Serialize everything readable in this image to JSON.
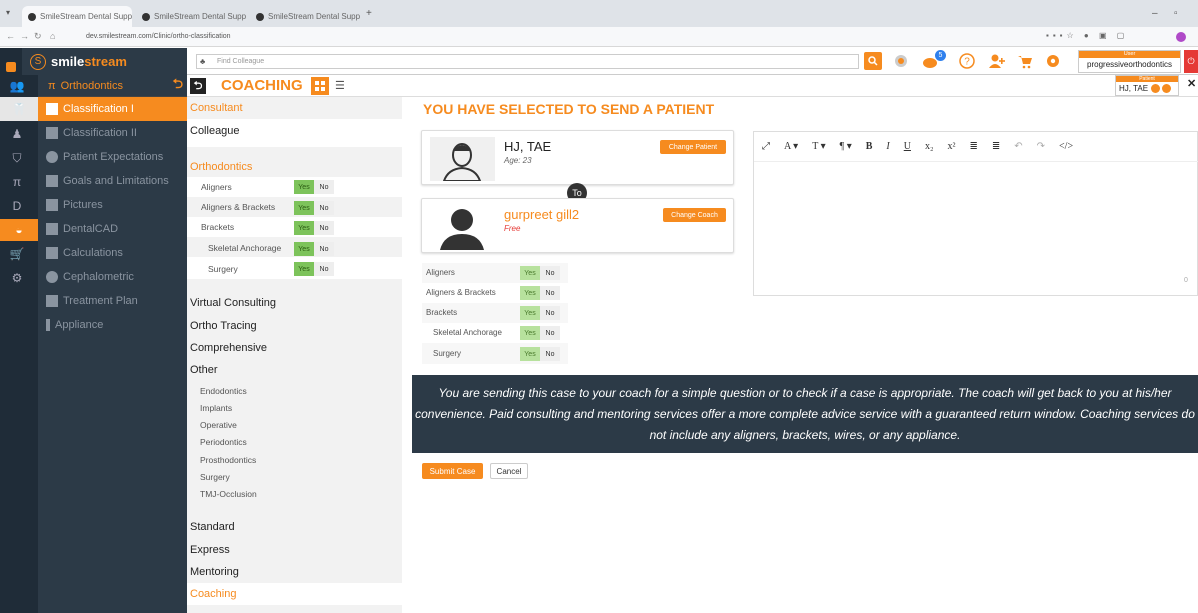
{
  "browser": {
    "tabs": [
      {
        "label": "SmileStream Dental Supply"
      },
      {
        "label": "SmileStream Dental Supply"
      },
      {
        "label": "SmileStream Dental Supply"
      }
    ],
    "url": "dev.smilestream.com/Clinic/ortho-classification"
  },
  "header": {
    "brand_part1": "smile",
    "brand_part2": "stream",
    "brand_logo": "S",
    "search_placeholder": "Find Colleague",
    "notification_count": "5",
    "user_role": "User",
    "user_name": "progressiveorthodontics",
    "patient_label": "Patient",
    "patient_name": "HJ, TAE"
  },
  "sidebar": {
    "header": "Orthodontics",
    "items": [
      {
        "label": "Classification I",
        "active": true
      },
      {
        "label": "Classification II"
      },
      {
        "label": "Patient Expectations"
      },
      {
        "label": "Goals and Limitations"
      },
      {
        "label": "Pictures"
      },
      {
        "label": "DentalCAD"
      },
      {
        "label": "Calculations"
      },
      {
        "label": "Cephalometric"
      },
      {
        "label": "Treatment Plan"
      },
      {
        "label": "Appliance"
      }
    ]
  },
  "coaching": {
    "title": "COACHING"
  },
  "options": {
    "consultant": "Consultant",
    "colleague": "Colleague",
    "orthodontics": "Orthodontics",
    "ortho_items": [
      {
        "label": "Aligners",
        "yes": "Yes",
        "no": "No"
      },
      {
        "label": "Aligners & Brackets",
        "yes": "Yes",
        "no": "No"
      },
      {
        "label": "Brackets",
        "yes": "Yes",
        "no": "No"
      },
      {
        "label": "Skeletal Anchorage",
        "yes": "Yes",
        "no": "No"
      },
      {
        "label": "Surgery",
        "yes": "Yes",
        "no": "No"
      }
    ],
    "virtual_consulting": "Virtual Consulting",
    "ortho_tracing": "Ortho Tracing",
    "comprehensive": "Comprehensive",
    "other": "Other",
    "other_items": [
      "Endodontics",
      "Implants",
      "Operative",
      "Periodontics",
      "Prosthodontics",
      "Surgery",
      "TMJ-Occlusion"
    ],
    "standard": "Standard",
    "express": "Express",
    "mentoring": "Mentoring",
    "coaching": "Coaching"
  },
  "main": {
    "title": "YOU HAVE SELECTED TO SEND A PATIENT",
    "patient": {
      "name": "HJ, TAE",
      "age": "Age: 23",
      "button": "Change Patient"
    },
    "to_label": "To",
    "coach": {
      "name": "gurpreet gill2",
      "status": "Free",
      "button": "Change Coach"
    },
    "items": [
      {
        "label": "Aligners",
        "yes": "Yes",
        "no": "No"
      },
      {
        "label": "Aligners & Brackets",
        "yes": "Yes",
        "no": "No"
      },
      {
        "label": "Brackets",
        "yes": "Yes",
        "no": "No"
      },
      {
        "label": "Skeletal Anchorage",
        "yes": "Yes",
        "no": "No"
      },
      {
        "label": "Surgery",
        "yes": "Yes",
        "no": "No"
      }
    ],
    "notice": "You are sending this case to your coach for a simple question or to check if a case is appropriate. The coach will get back to you at his/her convenience. Paid consulting and mentoring services offer a more complete advice service with a guaranteed return window. Coaching services do not include any aligners, brackets, wires, or any appliance.",
    "submit": "Submit Case",
    "cancel": "Cancel",
    "editor_counter": "0"
  },
  "editor_toolbar": [
    "⤢",
    "A ▾",
    "T ▾",
    "¶ ▾",
    "B",
    "I",
    "U",
    "x₂",
    "x²",
    "≣",
    "≣",
    "↶",
    "↷",
    "</>"
  ],
  "colors": {
    "accent": "#f68b1f",
    "dark": "#2c3a47",
    "yes": "#7dc35b"
  }
}
